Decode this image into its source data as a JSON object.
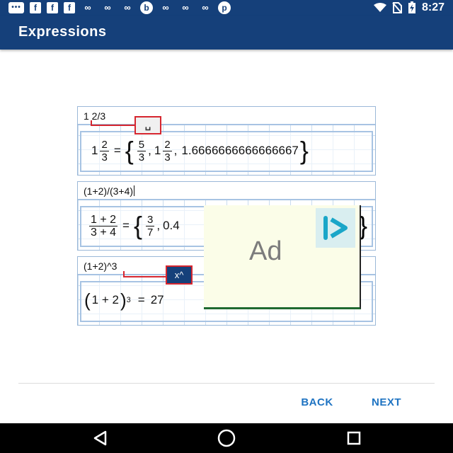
{
  "status_bar": {
    "time": "8:27",
    "notification_icons": [
      "message-dots-icon",
      "facebook-icon",
      "facebook-icon",
      "facebook-icon",
      "infinity-icon",
      "infinity-icon",
      "infinity-icon",
      "b-circle-icon",
      "infinity-icon",
      "infinity-icon",
      "infinity-icon",
      "pinterest-icon"
    ],
    "system_icons": [
      "wifi-icon",
      "no-sim-icon",
      "battery-charging-icon"
    ]
  },
  "app_bar": {
    "title": "Expressions"
  },
  "examples": [
    {
      "input": "1 2/3",
      "result": {
        "whole": "1",
        "num": "2",
        "den": "3",
        "eq": "=",
        "r1_num": "5",
        "r1_den": "3",
        "r2_whole": "1",
        "r2_num": "2",
        "r2_den": "3",
        "decimal": "1.6666666666666667",
        "comma": ","
      }
    },
    {
      "input": "(1+2)/(3+4)",
      "result": {
        "num": "1 + 2",
        "den": "3 + 4",
        "eq": "=",
        "r1_num": "3",
        "r1_den": "7",
        "decimal_partial": "0.4",
        "comma": ","
      }
    },
    {
      "input": "(1+2)^3",
      "result": {
        "open": "(",
        "body": "1 + 2",
        "close": ")",
        "exp": "3",
        "eq": "=",
        "value": "27"
      }
    }
  ],
  "key_hints": {
    "space_key": "␣",
    "power_key": "x^"
  },
  "ad": {
    "label": "Ad"
  },
  "footer": {
    "back": "BACK",
    "next": "NEXT"
  },
  "colors": {
    "primary": "#15407a",
    "accent": "#1e73c2",
    "hint_border": "#d6262f",
    "grid": "#c9dcef"
  }
}
